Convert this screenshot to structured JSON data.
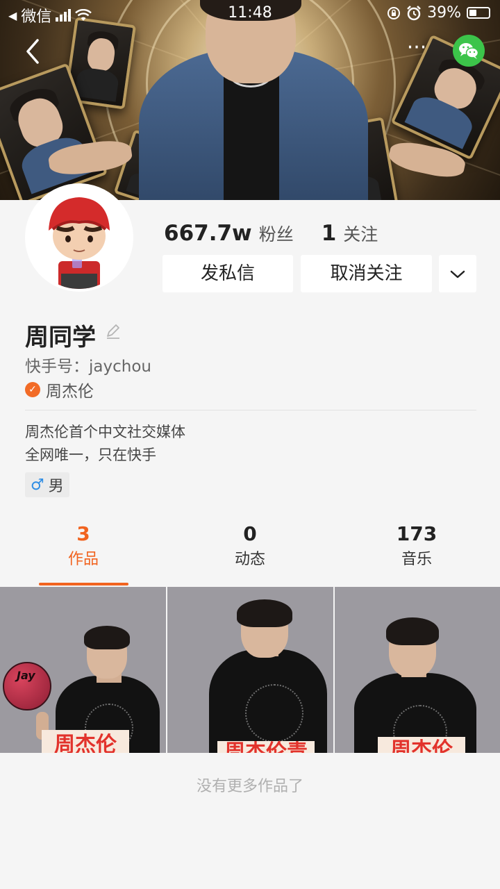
{
  "status_bar": {
    "carrier": "微信",
    "time": "11:48",
    "battery": "39%",
    "battery_level": 0.39
  },
  "nav": {
    "back_icon": "chevron-left-icon",
    "more_icon": "more-dots-icon",
    "more_label": "···",
    "share_icon": "wechat-icon"
  },
  "profile": {
    "followers_count": "667.7w",
    "followers_label": "粉丝",
    "following_count": "1",
    "following_label": "关注",
    "message_button": "发私信",
    "unfollow_button": "取消关注",
    "name": "周同学",
    "kuaishou_id": "快手号：jaychou",
    "verified_name": "周杰伦",
    "verified_mark": "✓",
    "bio_lines": [
      "周杰伦首个中文社交媒体",
      "全网唯一，只在快手"
    ],
    "gender_symbol": "♂",
    "gender": "男"
  },
  "tabs": [
    {
      "count": "3",
      "label": "作品",
      "active": true
    },
    {
      "count": "0",
      "label": "动态",
      "active": false
    },
    {
      "count": "173",
      "label": "音乐",
      "active": false
    }
  ],
  "works": [
    {
      "caption": "周杰伦",
      "ball_text": "Jay"
    },
    {
      "caption": "周杰伦青"
    },
    {
      "caption": "周杰伦"
    }
  ],
  "footer_text": "没有更多作品了",
  "colors": {
    "accent": "#f1631f",
    "verified_badge": "#f26b26",
    "wechat": "#3cc44a",
    "gender_icon": "#2f8de4"
  }
}
